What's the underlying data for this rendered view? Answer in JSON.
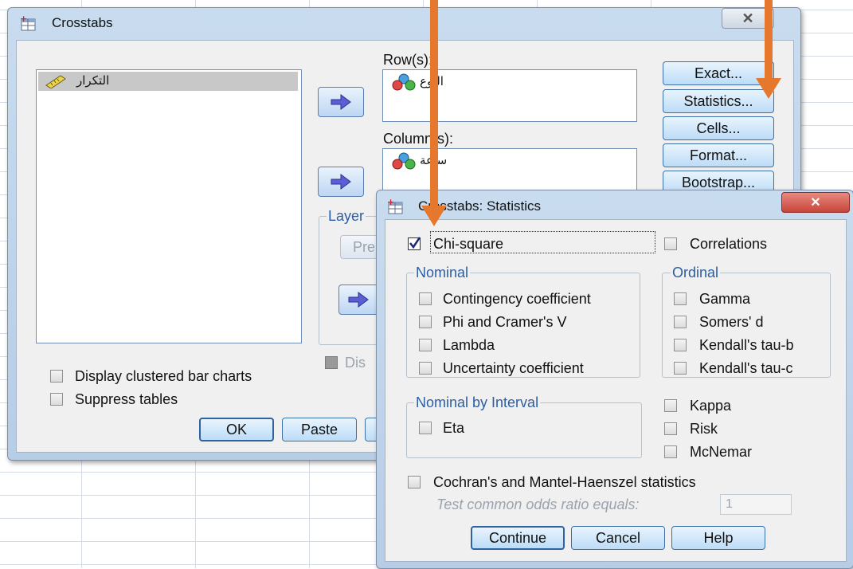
{
  "crosstabs": {
    "title": "Crosstabs",
    "variable_list": [
      "التكرار"
    ],
    "row_label": "Row(s):",
    "row_vars": [
      "النوع"
    ],
    "column_label": "Column(s):",
    "column_vars": [
      "ساعة"
    ],
    "layer_label": "Layer",
    "prev_label": "Pre",
    "disp_label": "Dis",
    "buttons": {
      "exact": "Exact...",
      "statistics": "Statistics...",
      "cells": "Cells...",
      "format": "Format...",
      "bootstrap": "Bootstrap..."
    },
    "clustered_label": "Display clustered bar charts",
    "suppress_label": "Suppress tables",
    "ok": "OK",
    "paste": "Paste"
  },
  "stats": {
    "title": "Crosstabs: Statistics",
    "chi_square": "Chi-square",
    "correlations": "Correlations",
    "nominal": {
      "title": "Nominal",
      "items": [
        "Contingency coefficient",
        "Phi and Cramer's V",
        "Lambda",
        "Uncertainty coefficient"
      ]
    },
    "ordinal": {
      "title": "Ordinal",
      "items": [
        "Gamma",
        "Somers' d",
        "Kendall's tau-b",
        "Kendall's tau-c"
      ]
    },
    "nominal_interval": {
      "title": "Nominal by Interval",
      "items": [
        "Eta"
      ]
    },
    "right_items": [
      "Kappa",
      "Risk",
      "McNemar"
    ],
    "cochran": "Cochran's and Mantel-Haenszel statistics",
    "odds_label": "Test common odds ratio equals:",
    "odds_value": "1",
    "continue": "Continue",
    "cancel": "Cancel",
    "help": "Help"
  },
  "checked": {
    "chi_square": true
  },
  "colors": {
    "arrow": "#e6782e",
    "accent": "#2b5ea3",
    "close_red": "#c8453b"
  }
}
